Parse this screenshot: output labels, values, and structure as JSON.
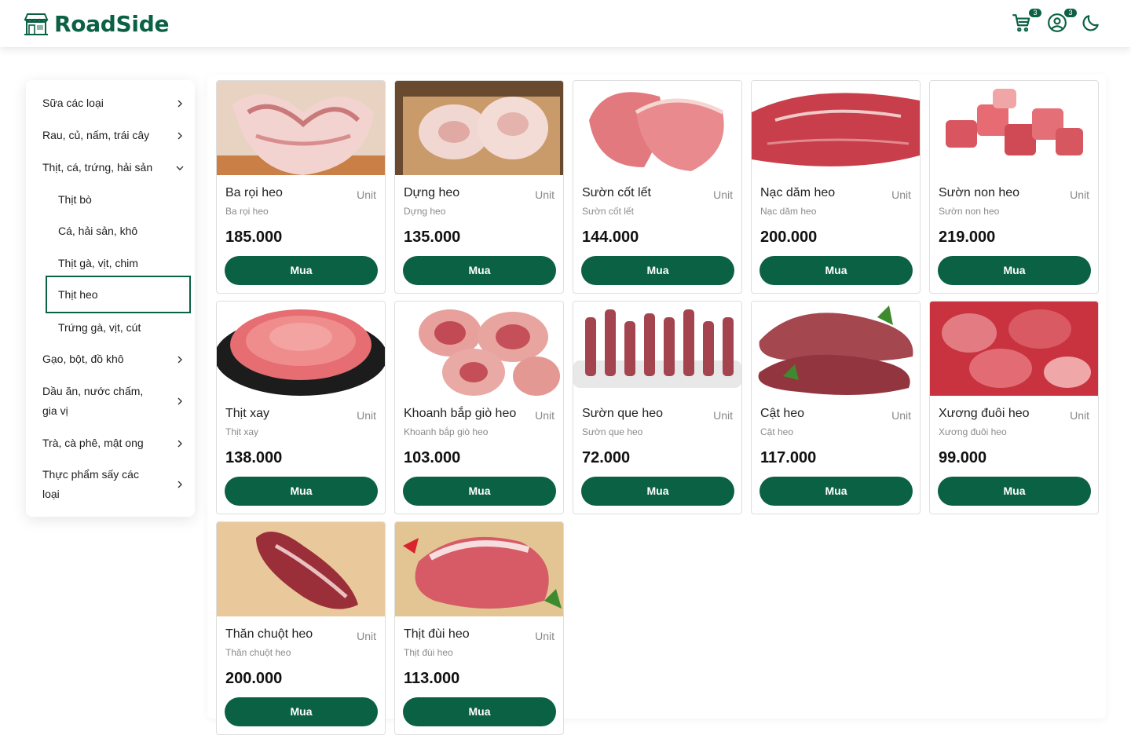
{
  "header": {
    "brand": "RoadSide",
    "cart_count": "3",
    "account_count": "3",
    "icons": [
      "storefront-logo-icon",
      "cart-icon",
      "user-icon",
      "moon-icon"
    ],
    "accent_color": "#0b6144"
  },
  "sidebar": {
    "categories": [
      {
        "label": "Sữa các loại",
        "label2": ""
      },
      {
        "label": "Rau, củ, nấm, trái cây",
        "label2": ""
      },
      {
        "label": "Thịt, cá, trứng, hải sản",
        "label2": "",
        "expanded": true
      },
      {
        "label": "Gạo, bột, đồ khô",
        "label2": ""
      },
      {
        "label": "Dầu ăn, nước chấm,",
        "label2": "gia vị"
      },
      {
        "label": "Trà, cà phê, mật ong",
        "label2": ""
      },
      {
        "label": "Thực phẩm sấy các",
        "label2": "loại"
      }
    ],
    "subcategories": [
      {
        "label": "Thịt bò"
      },
      {
        "label": "Cá, hải sản, khô"
      },
      {
        "label": "Thịt gà, vịt, chim"
      },
      {
        "label": "Thịt heo",
        "active": true
      },
      {
        "label": "Trứng gà, vịt, cút"
      }
    ]
  },
  "products": [
    {
      "name": "Ba rọi heo",
      "desc": "Ba rọi heo",
      "unit": "Unit",
      "price": "185.000",
      "button": "Mua"
    },
    {
      "name": "Dựng heo",
      "desc": "Dựng heo",
      "unit": "Unit",
      "price": "135.000",
      "button": "Mua"
    },
    {
      "name": "Sườn cốt lết",
      "desc": "Sườn cốt lết",
      "unit": "Unit",
      "price": "144.000",
      "button": "Mua"
    },
    {
      "name": "Nạc dăm heo",
      "desc": "Nạc dăm heo",
      "unit": "Unit",
      "price": "200.000",
      "button": "Mua"
    },
    {
      "name": "Sườn non heo",
      "desc": "Sườn non heo",
      "unit": "Unit",
      "price": "219.000",
      "button": "Mua"
    },
    {
      "name": "Thịt xay",
      "desc": "Thịt xay",
      "unit": "Unit",
      "price": "138.000",
      "button": "Mua"
    },
    {
      "name": "Khoanh bắp giò heo",
      "desc": "Khoanh bắp giò heo",
      "unit": "Unit",
      "price": "103.000",
      "button": "Mua"
    },
    {
      "name": "Sườn que heo",
      "desc": "Sườn que heo",
      "unit": "Unit",
      "price": "72.000",
      "button": "Mua"
    },
    {
      "name": "Cật heo",
      "desc": "Cật heo",
      "unit": "Unit",
      "price": "117.000",
      "button": "Mua"
    },
    {
      "name": "Xương đuôi heo",
      "desc": "Xương đuôi heo",
      "unit": "Unit",
      "price": "99.000",
      "button": "Mua"
    },
    {
      "name": "Thăn chuột heo",
      "desc": "Thăn chuột heo",
      "unit": "Unit",
      "price": "200.000",
      "button": "Mua"
    },
    {
      "name": "Thịt đùi heo",
      "desc": "Thịt đùi heo",
      "unit": "Unit",
      "price": "113.000",
      "button": "Mua"
    }
  ]
}
